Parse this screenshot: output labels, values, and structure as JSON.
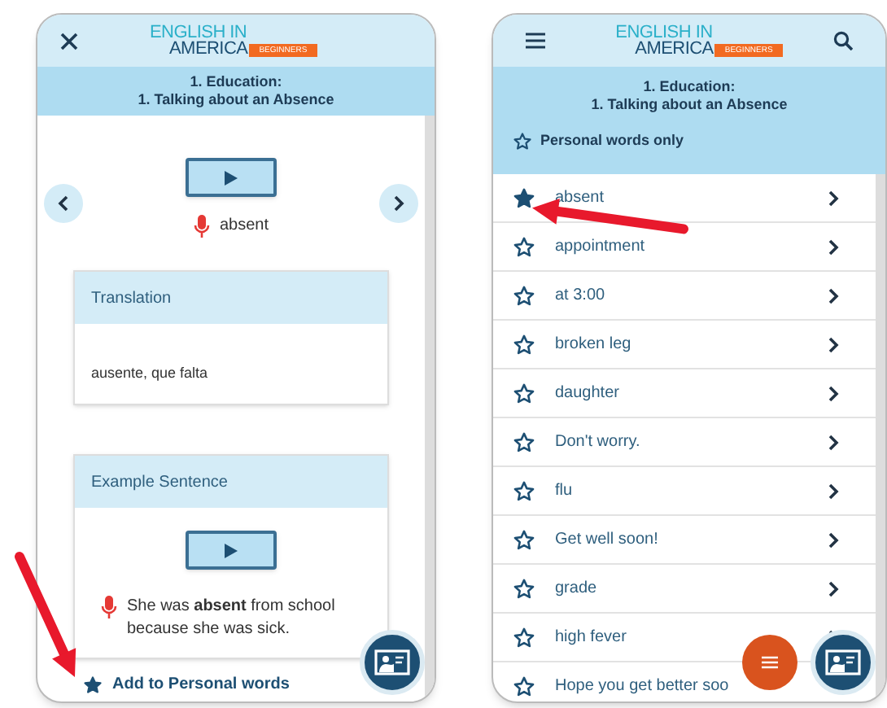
{
  "detail_screen": {
    "logo": {
      "line_1": "ENGLISH IN",
      "line_2": "AMERICA",
      "badge": "BEGINNERS"
    },
    "title_1": "1. Education:",
    "title_2": "1. Talking about an Absence",
    "word": "absent",
    "cards": [
      {
        "kind": "text",
        "heading": "Translation",
        "body": "ausente, que falta"
      },
      {
        "kind": "audio",
        "heading": "Example Sentence",
        "body": "She was **absent** from school because she was sick."
      }
    ],
    "personal_toggle": {
      "label": "Add to Personal words",
      "starred": true
    }
  },
  "list_screen": {
    "logo": {
      "line_1": "ENGLISH IN",
      "line_2": "AMERICA",
      "badge": "BEGINNERS"
    },
    "title_1": "1. Education:",
    "title_2": "1. Talking about an Absence",
    "filter": {
      "label": "Personal words only",
      "starred": false
    },
    "words": [
      {
        "label": "absent",
        "starred": true
      },
      {
        "label": "appointment",
        "starred": false
      },
      {
        "label": "at 3:00",
        "starred": false
      },
      {
        "label": "broken leg",
        "starred": false
      },
      {
        "label": "daughter",
        "starred": false
      },
      {
        "label": "Don't worry.",
        "starred": false
      },
      {
        "label": "flu",
        "starred": false
      },
      {
        "label": "Get well soon!",
        "starred": false
      },
      {
        "label": "grade",
        "starred": false
      },
      {
        "label": "high fever",
        "starred": false
      },
      {
        "label": "Hope you get better soo",
        "starred": false
      }
    ]
  }
}
